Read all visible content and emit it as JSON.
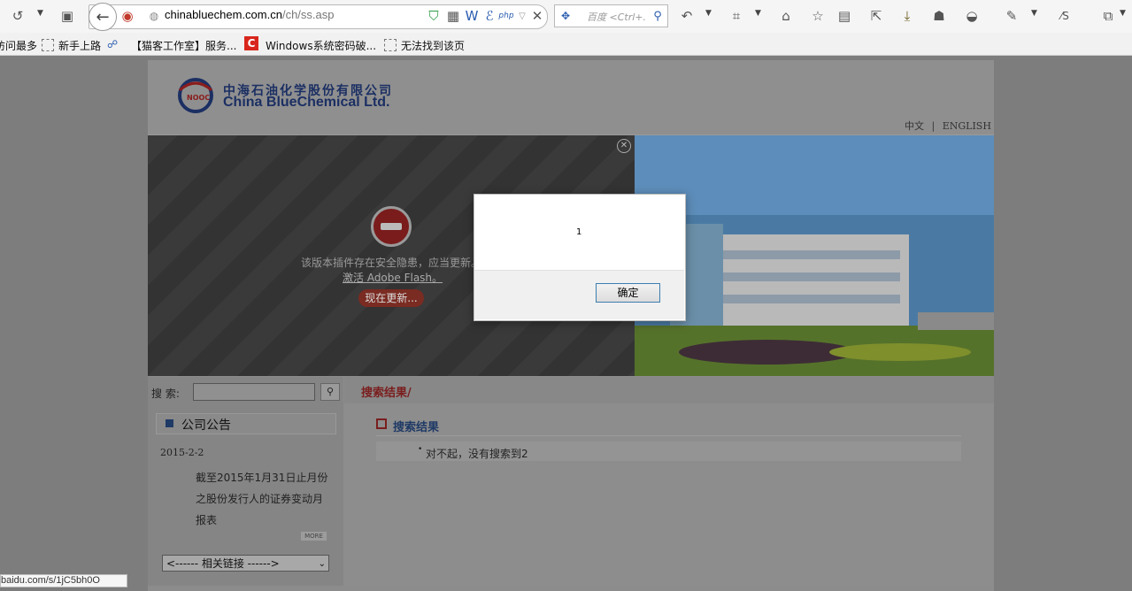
{
  "browser": {
    "url_host": "chinabluechem.com.cn",
    "url_path": "/ch/ss.asp",
    "search_placeholder": "百度 <Ctrl+.",
    "bookmarks": [
      "访问最多",
      "新手上路",
      "【猫客工作室】服务...",
      "Windows系统密码破...",
      "无法找到该页"
    ],
    "status_url": "baidu.com/s/1jC5bh0O"
  },
  "site": {
    "logo_cn": "中海石油化学股份有限公司",
    "logo_en": "China BlueChemical Ltd.",
    "lang_cn": "中文",
    "lang_sep": "|",
    "lang_en": "ENGLISH"
  },
  "flash": {
    "message": "该版本插件存在安全隐患，应当更新。",
    "link": "激活 Adobe Flash。",
    "update_button": "现在更新..."
  },
  "sidebar": {
    "search_label": "搜 索:",
    "notice_title": "公司公告",
    "notice_date": "2015-2-2",
    "notice_text": "截至2015年1月31日止月份之股份发行人的证券变动月报表",
    "more_label": "MORE",
    "links_select": "<------  相关链接  ------>"
  },
  "main": {
    "breadcrumb": "搜索结果/",
    "result_title": "搜索结果",
    "result_text": "对不起，没有搜索到2"
  },
  "dialog": {
    "message": "1",
    "ok_label": "确定"
  }
}
